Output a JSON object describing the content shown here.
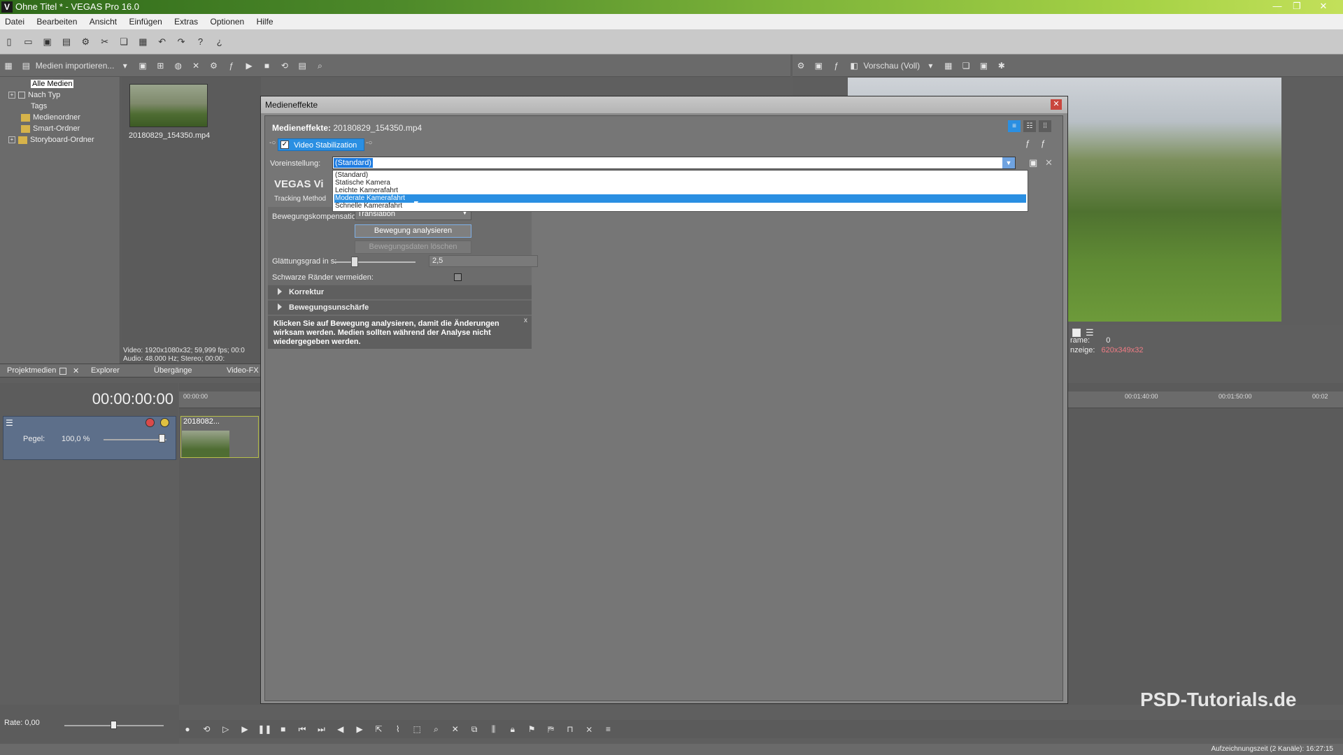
{
  "window": {
    "title": "Ohne Titel * - VEGAS Pro 16.0",
    "app_icon": "V",
    "min": "—",
    "max": "❐",
    "close": "✕"
  },
  "menu": [
    "Datei",
    "Bearbeiten",
    "Ansicht",
    "Einfügen",
    "Extras",
    "Optionen",
    "Hilfe"
  ],
  "media_toolbar": {
    "import_label": "Medien importieren..."
  },
  "preview_toolbar": {
    "label": "Vorschau (Voll)"
  },
  "tree": {
    "items": [
      {
        "label": "Alle Medien",
        "selected": true
      },
      {
        "label": "Nach Typ",
        "expandable": true
      },
      {
        "label": "Tags"
      },
      {
        "label": "Medienordner"
      },
      {
        "label": "Smart-Ordner"
      },
      {
        "label": "Storyboard-Ordner",
        "expandable": true
      }
    ]
  },
  "media": {
    "filename": "20180829_154350.mp4",
    "info_video": "Video: 1920x1080x32; 59,999 fps; 00:0",
    "info_audio": "Audio: 48.000 Hz; Stereo; 00:00:"
  },
  "bottom_tabs": [
    "Projektmedien",
    "Explorer",
    "Übergänge",
    "Video-FX"
  ],
  "preview": {
    "frame_label": "rame:",
    "frame_value": "0",
    "display_label": "nzeige:",
    "display_value": "620x349x32"
  },
  "timeline": {
    "timecode": "00:00:00:00",
    "track_level_label": "Pegel:",
    "track_level_value": "100,0 %",
    "clip_title": "2018082...",
    "ruler": [
      "00:00:00",
      "00:01:40:00",
      "00:01:50:00",
      "00:02"
    ],
    "rate_label": "Rate: 0,00"
  },
  "statusbar": {
    "text": "Aufzeichnungszeit (2 Kanäle): 16:27:15"
  },
  "watermark": "PSD-Tutorials.de",
  "dialog": {
    "title": "Medieneffekte",
    "header_label": "Medieneffekte:",
    "header_file": "20180829_154350.mp4",
    "fx_name": "Video Stabilization",
    "preset_label": "Voreinstellung:",
    "preset_value": "(Standard)",
    "preset_options": [
      "(Standard)",
      "Statische Kamera",
      "Leichte Kamerafahrt",
      "Moderate Kamerafahrt",
      "Schnelle Kamerafahrt"
    ],
    "highlighted_option": 3,
    "heading": "VEGAS Vi",
    "tracking_label": "Tracking Method",
    "motion_label": "Bewegungskompensation:",
    "motion_value": "Translation",
    "analyze_button": "Bewegung analysieren",
    "clear_button": "Bewegungsdaten löschen",
    "smooth_label": "Glättungsgrad in s:",
    "smooth_value": "2,5",
    "smooth_fraction": 0.25,
    "borders_label": "Schwarze Ränder vermeiden:",
    "sections": [
      "Korrektur",
      "Bewegungsunschärfe"
    ],
    "info": "Klicken Sie auf Bewegung analysieren, damit die Änderungen wirksam werden. Medien sollten während der Analyse nicht wiedergegeben werden.",
    "info_close": "x"
  }
}
